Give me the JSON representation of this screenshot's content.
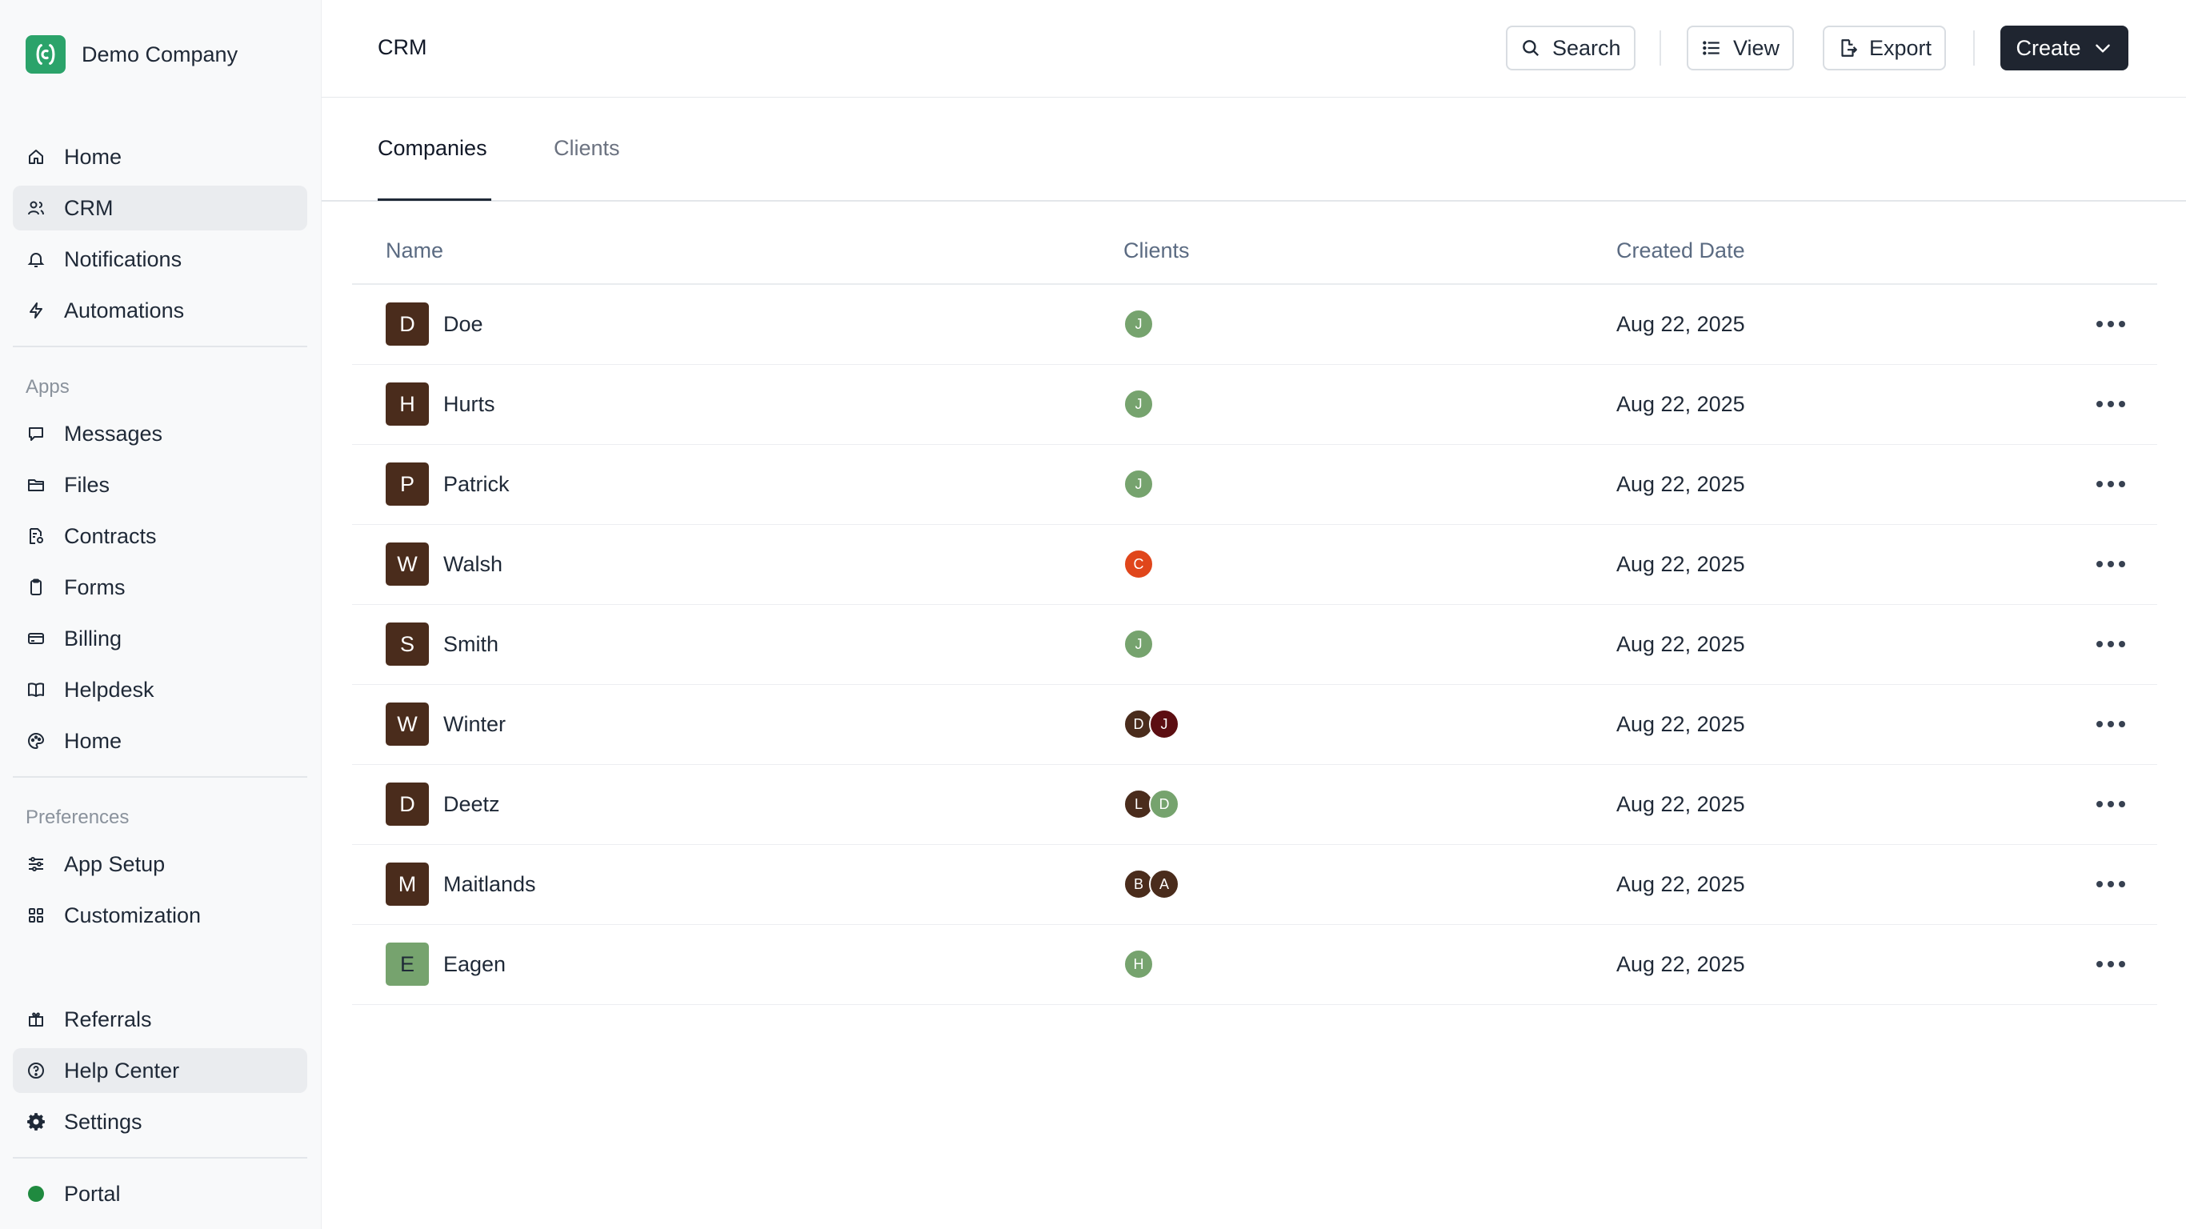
{
  "brand": {
    "name": "Demo Company",
    "logo_color": "#2ba36a"
  },
  "sidebar": {
    "primary": [
      {
        "label": "Home",
        "icon": "home-icon",
        "active": false
      },
      {
        "label": "CRM",
        "icon": "users-icon",
        "active": true
      },
      {
        "label": "Notifications",
        "icon": "bell-icon",
        "active": false
      },
      {
        "label": "Automations",
        "icon": "bolt-icon",
        "active": false
      }
    ],
    "apps_label": "Apps",
    "apps": [
      {
        "label": "Messages",
        "icon": "message-icon"
      },
      {
        "label": "Files",
        "icon": "folder-icon"
      },
      {
        "label": "Contracts",
        "icon": "contract-icon"
      },
      {
        "label": "Forms",
        "icon": "clipboard-icon"
      },
      {
        "label": "Billing",
        "icon": "credit-card-icon"
      },
      {
        "label": "Helpdesk",
        "icon": "book-icon"
      },
      {
        "label": "Home",
        "icon": "palette-icon"
      }
    ],
    "preferences_label": "Preferences",
    "preferences": [
      {
        "label": "App Setup",
        "icon": "sliders-icon"
      },
      {
        "label": "Customization",
        "icon": "grid-icon"
      }
    ],
    "bottom": [
      {
        "label": "Referrals",
        "icon": "gift-icon",
        "active": false
      },
      {
        "label": "Help Center",
        "icon": "help-circle-icon",
        "active": true
      },
      {
        "label": "Settings",
        "icon": "gear-icon",
        "active": false
      }
    ],
    "portal": {
      "label": "Portal",
      "status_color": "#1f8a3f"
    }
  },
  "header": {
    "title": "CRM",
    "search_label": "Search",
    "view_label": "View",
    "export_label": "Export",
    "create_label": "Create"
  },
  "tabs": [
    {
      "label": "Companies",
      "active": true
    },
    {
      "label": "Clients",
      "active": false
    }
  ],
  "table": {
    "columns": [
      "Name",
      "Clients",
      "Created Date"
    ],
    "rows": [
      {
        "initial": "D",
        "name": "Doe",
        "avatar_color": "#4a2c1c",
        "clients": [
          {
            "initial": "J",
            "color": "#76a36e"
          }
        ],
        "date": "Aug 22, 2025"
      },
      {
        "initial": "H",
        "name": "Hurts",
        "avatar_color": "#4a2c1c",
        "clients": [
          {
            "initial": "J",
            "color": "#76a36e"
          }
        ],
        "date": "Aug 22, 2025"
      },
      {
        "initial": "P",
        "name": "Patrick",
        "avatar_color": "#4a2c1c",
        "clients": [
          {
            "initial": "J",
            "color": "#76a36e"
          }
        ],
        "date": "Aug 22, 2025"
      },
      {
        "initial": "W",
        "name": "Walsh",
        "avatar_color": "#4a2c1c",
        "clients": [
          {
            "initial": "C",
            "color": "#e0461b"
          }
        ],
        "date": "Aug 22, 2025"
      },
      {
        "initial": "S",
        "name": "Smith",
        "avatar_color": "#4a2c1c",
        "clients": [
          {
            "initial": "J",
            "color": "#76a36e"
          }
        ],
        "date": "Aug 22, 2025"
      },
      {
        "initial": "W",
        "name": "Winter",
        "avatar_color": "#4a2c1c",
        "clients": [
          {
            "initial": "D",
            "color": "#4a2c1c"
          },
          {
            "initial": "J",
            "color": "#5c0e12"
          }
        ],
        "date": "Aug 22, 2025"
      },
      {
        "initial": "D",
        "name": "Deetz",
        "avatar_color": "#4a2c1c",
        "clients": [
          {
            "initial": "L",
            "color": "#4a2c1c"
          },
          {
            "initial": "D",
            "color": "#76a36e"
          }
        ],
        "date": "Aug 22, 2025"
      },
      {
        "initial": "M",
        "name": "Maitlands",
        "avatar_color": "#4a2c1c",
        "clients": [
          {
            "initial": "B",
            "color": "#4a2c1c"
          },
          {
            "initial": "A",
            "color": "#4a2c1c"
          }
        ],
        "date": "Aug 22, 2025"
      },
      {
        "initial": "E",
        "name": "Eagen",
        "avatar_color": "#76a36e",
        "clients": [
          {
            "initial": "H",
            "color": "#76a36e"
          }
        ],
        "date": "Aug 22, 2025"
      }
    ]
  }
}
